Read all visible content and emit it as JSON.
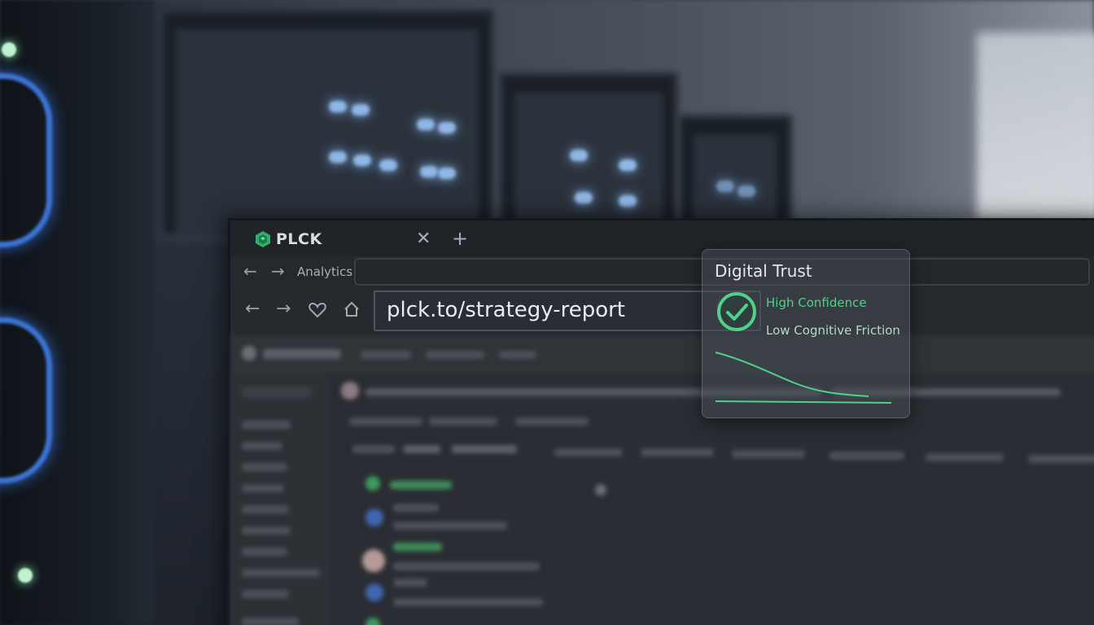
{
  "browser": {
    "brand": "PLCK",
    "crumb": "Analytics",
    "url": "plck.to/strategy-report"
  },
  "trust_panel": {
    "title": "Digital Trust",
    "confidence": "High Confidence",
    "friction": "Low Cognitive Friction"
  },
  "colors": {
    "accent_green": "#4fd18a",
    "led_blue": "#8fb7e6",
    "ring_blue": "#3b74d4",
    "panel_bg": "#25292f"
  },
  "icons": [
    "plck-logo-icon",
    "close-icon",
    "plus-icon",
    "back-arrow-icon",
    "forward-arrow-icon",
    "heart-icon",
    "home-icon",
    "check-circle-icon"
  ]
}
